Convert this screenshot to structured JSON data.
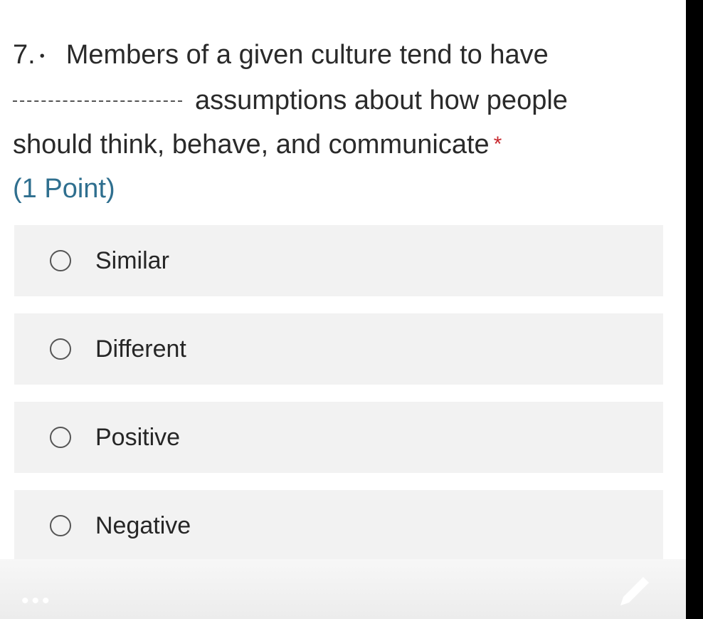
{
  "question": {
    "number": "7.",
    "bullet": "•",
    "line1": "Members of a given culture tend to have",
    "line2": "assumptions about how people",
    "line3": "should think, behave, and communicate",
    "required": "*",
    "points": "(1 Point)"
  },
  "options": [
    {
      "label": "Similar"
    },
    {
      "label": "Different"
    },
    {
      "label": "Positive"
    },
    {
      "label": "Negative"
    }
  ],
  "footer": {
    "dots": "•••"
  },
  "colors": {
    "required": "#c8282e",
    "points": "#2f6f8f",
    "option_bg": "#f2f2f2"
  },
  "icons": [
    "radio-button-icon",
    "ellipsis-icon",
    "pencil-icon"
  ]
}
